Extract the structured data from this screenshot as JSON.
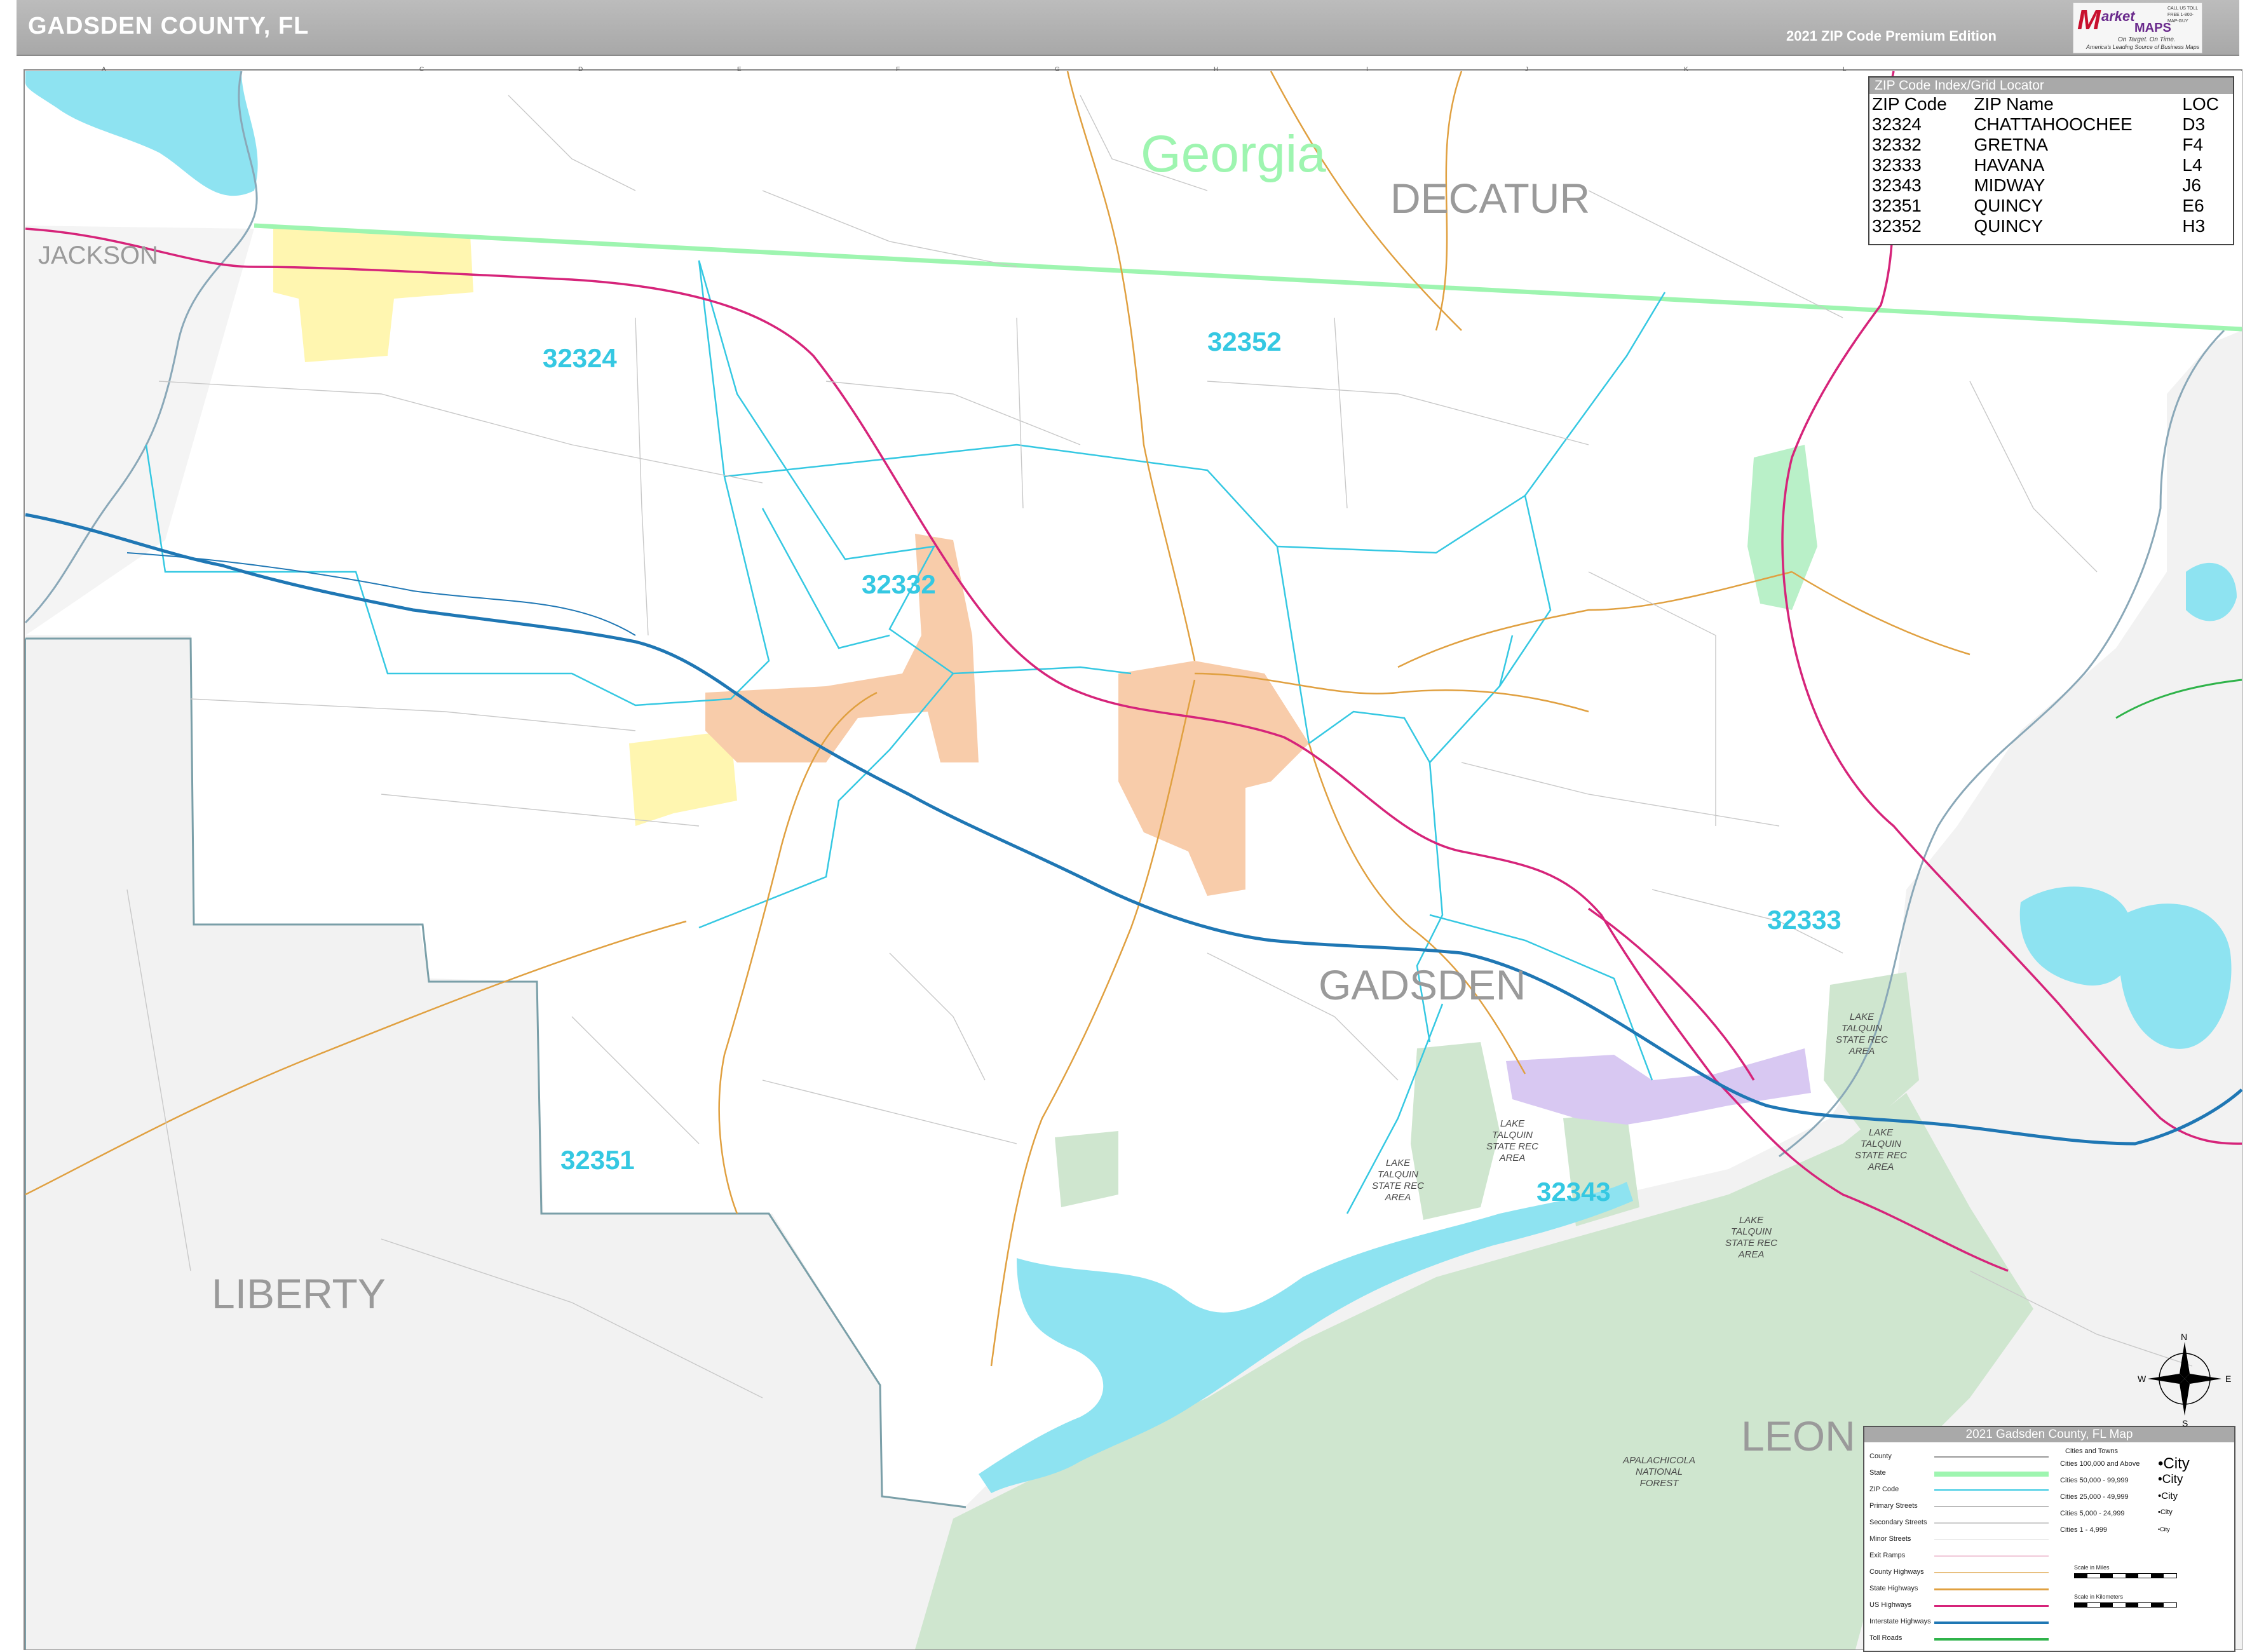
{
  "header": {
    "title": "GADSDEN COUNTY, FL",
    "edition": "2021 ZIP Code Premium Edition"
  },
  "logo": {
    "mark": "M",
    "word1": "arket",
    "word2": "MAPS",
    "tagline1": "On Target. On Time.",
    "tagline2": "America's Leading Source of Business Maps",
    "contact": "CALL US TOLL FREE 1-800-MAP-GUY"
  },
  "map": {
    "state_label": "Georgia",
    "regions": {
      "decatur": "DECATUR",
      "jackson": "JACKSON",
      "gadsden": "GADSDEN",
      "liberty": "LIBERTY",
      "leon": "LEON"
    },
    "zip_labels": {
      "z32324": "32324",
      "z32352": "32352",
      "z32332": "32332",
      "z32333": "32333",
      "z32351": "32351",
      "z32343": "32343"
    },
    "parks": {
      "lake_talquin_1": "LAKE TALQUIN STATE REC AREA",
      "lake_talquin_2": "LAKE TALQUIN STATE REC AREA",
      "lake_talquin_3": "LAKE TALQUIN STATE REC AREA",
      "lake_talquin_4": "LAKE TALQUIN STATE REC AREA",
      "lake_talquin_5": "LAKE TALQUIN STATE REC AREA",
      "apalachicola": "APALACHICOLA NATIONAL FOREST"
    }
  },
  "zip_index": {
    "caption": "ZIP Code Index/Grid Locator",
    "columns": [
      "ZIP Code",
      "ZIP Name",
      "LOC"
    ],
    "rows": [
      [
        "32324",
        "CHATTAHOOCHEE",
        "D3"
      ],
      [
        "32332",
        "GRETNA",
        "F4"
      ],
      [
        "32333",
        "HAVANA",
        "L4"
      ],
      [
        "32343",
        "MIDWAY",
        "J6"
      ],
      [
        "32351",
        "QUINCY",
        "E6"
      ],
      [
        "32352",
        "QUINCY",
        "H3"
      ]
    ]
  },
  "legend": {
    "caption": "2021 Gadsden County, FL Map",
    "items": [
      "County",
      "State",
      "ZIP Code",
      "Primary Streets",
      "Secondary Streets",
      "Minor Streets",
      "Exit Ramps",
      "County Highways",
      "State Highways",
      "US Highways",
      "Interstate Highways",
      "Toll Roads"
    ],
    "cities_head": "Cities and Towns",
    "cities": [
      [
        "Cities 100,000 and Above",
        "•City"
      ],
      [
        "Cities 50,000 - 99,999",
        "•City"
      ],
      [
        "Cities 25,000 - 49,999",
        "•City"
      ],
      [
        "Cities 5,000 - 24,999",
        "•City"
      ],
      [
        "Cities 1 - 4,999",
        "•City"
      ]
    ],
    "scale_miles": "Scale in Miles",
    "scale_km": "Scale in Kilometers"
  },
  "compass": {
    "n": "N",
    "s": "S",
    "e": "E",
    "w": "W"
  },
  "colors": {
    "water": "#8ee3f1",
    "forest": "#cfe6cf",
    "outside": "#f2f2f2",
    "state_line": "#9ef5b0",
    "zip_line": "#35c8e2",
    "interstate": "#1f77b4",
    "us_highway": "#d6247a",
    "state_highway": "#e0a040",
    "chattahoochee": "#fff6b0",
    "gretna_quincy": "#f8ccaa",
    "havana": "#b9f0c8",
    "midway": "#d8c8f2"
  }
}
